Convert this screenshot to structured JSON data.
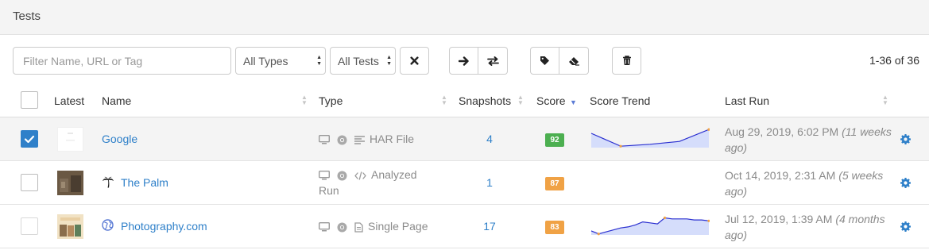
{
  "page": {
    "title": "Tests"
  },
  "toolbar": {
    "filter_placeholder": "Filter Name, URL or Tag",
    "type_select": "All Types",
    "tests_select": "All Tests",
    "count_text": "1-36 of 36"
  },
  "table": {
    "columns": {
      "latest": "Latest",
      "name": "Name",
      "type": "Type",
      "snapshots": "Snapshots",
      "score": "Score",
      "score_trend": "Score Trend",
      "last_run": "Last Run"
    },
    "rows": [
      {
        "name": "Google",
        "type_label": "HAR File",
        "type_icon": "list-icon",
        "snapshots": "4",
        "score": "92",
        "score_color": "#4caf50",
        "last_run": "Aug 29, 2019, 6:02 PM",
        "last_run_relative": "(11 weeks ago)",
        "checked": true,
        "trend": [
          72,
          45,
          49,
          55,
          80
        ]
      },
      {
        "name": "The Palm",
        "type_label": "Analyzed Run",
        "type_icon": "code-icon",
        "snapshots": "1",
        "score": "87",
        "score_color": "#f0a245",
        "last_run": "Oct 14, 2019, 2:31 AM",
        "last_run_relative": "(5 weeks ago)",
        "checked": false,
        "trend": []
      },
      {
        "name": "Photography.com",
        "type_label": "Single Page",
        "type_icon": "document-icon",
        "snapshots": "17",
        "score": "83",
        "score_color": "#f0a245",
        "last_run": "Jul 12, 2019, 1:39 AM",
        "last_run_relative": "(4 months ago)",
        "checked": false,
        "trend": [
          76,
          73,
          75,
          77,
          79,
          80,
          82,
          85,
          84,
          83,
          89,
          88,
          88,
          88,
          87,
          87,
          86
        ]
      }
    ]
  },
  "colors": {
    "link": "#2f80c9",
    "accent_check": "#2f80c9",
    "trend_line": "#2a2fd0",
    "trend_fill": "#d5ddfb",
    "trend_point": "#f0a245"
  }
}
